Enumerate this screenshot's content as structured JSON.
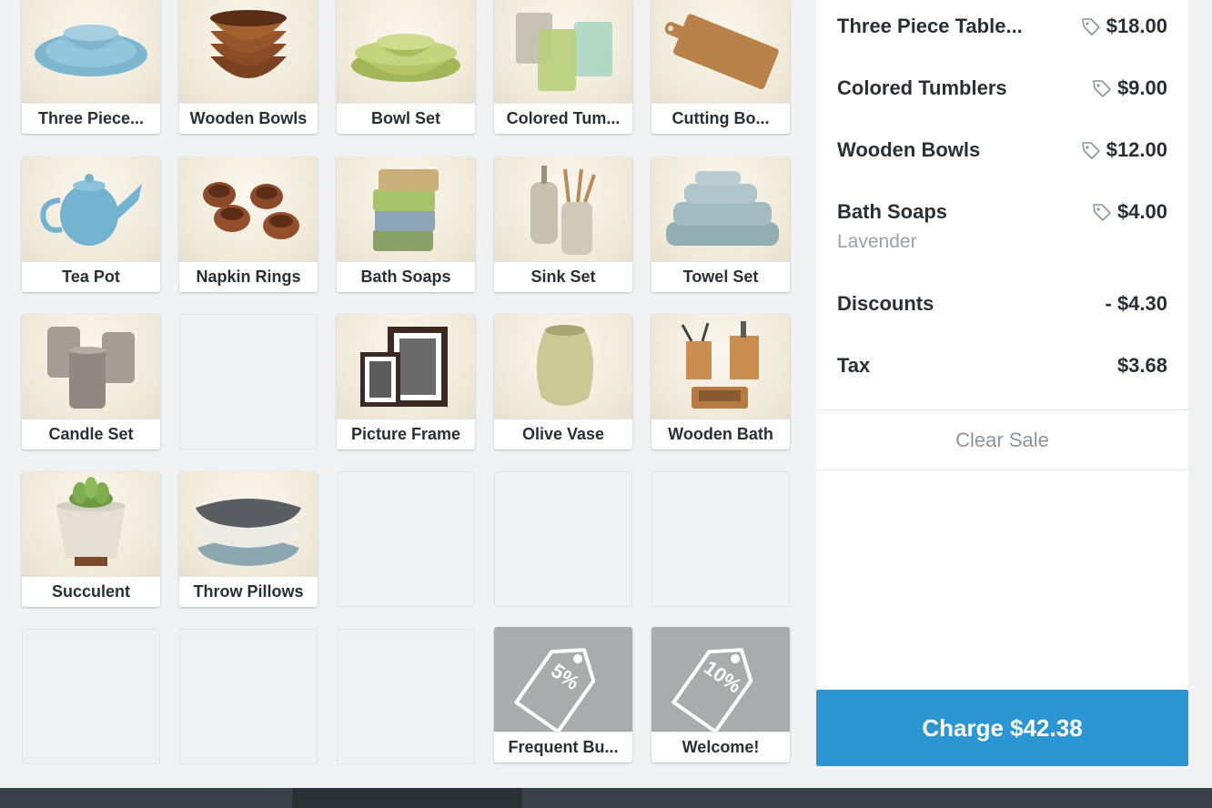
{
  "grid": {
    "items": [
      {
        "label": "Three Piece...",
        "icon": "plate-set-icon"
      },
      {
        "label": "Wooden Bowls",
        "icon": "wooden-bowls-icon"
      },
      {
        "label": "Bowl Set",
        "icon": "bowl-set-icon"
      },
      {
        "label": "Colored Tum...",
        "icon": "tumblers-icon"
      },
      {
        "label": "Cutting Bo...",
        "icon": "cutting-board-icon"
      },
      {
        "label": "Tea Pot",
        "icon": "teapot-icon"
      },
      {
        "label": "Napkin Rings",
        "icon": "napkin-rings-icon"
      },
      {
        "label": "Bath Soaps",
        "icon": "soaps-icon"
      },
      {
        "label": "Sink Set",
        "icon": "sink-set-icon"
      },
      {
        "label": "Towel Set",
        "icon": "towels-icon"
      },
      {
        "label": "Candle Set",
        "icon": "candles-icon"
      },
      {
        "label": "Picture Frame",
        "icon": "picture-frame-icon"
      },
      {
        "label": "Olive Vase",
        "icon": "vase-icon"
      },
      {
        "label": "Wooden Bath",
        "icon": "bath-set-icon"
      },
      {
        "label": "Succulent",
        "icon": "succulent-icon"
      },
      {
        "label": "Throw Pillows",
        "icon": "pillows-icon"
      }
    ],
    "discounts": [
      {
        "label": "Frequent Bu...",
        "badge": "5%",
        "icon": "discount-tag-icon"
      },
      {
        "label": "Welcome!",
        "badge": "10%",
        "icon": "discount-tag-icon"
      }
    ]
  },
  "cart": {
    "lines": [
      {
        "name": "Three Piece Table...",
        "price": "$18.00",
        "variant": ""
      },
      {
        "name": "Colored Tumblers",
        "price": "$9.00",
        "variant": ""
      },
      {
        "name": "Wooden Bowls",
        "price": "$12.00",
        "variant": ""
      },
      {
        "name": "Bath Soaps",
        "price": "$4.00",
        "variant": "Lavender"
      }
    ],
    "discounts_label": "Discounts",
    "discounts_value": "- $4.30",
    "tax_label": "Tax",
    "tax_value": "$3.68",
    "clear_sale": "Clear Sale",
    "charge": "Charge $42.38"
  },
  "colors": {
    "accent": "#2b96d2",
    "background": "#f0f1f3",
    "discount_tile": "#a9abad"
  }
}
